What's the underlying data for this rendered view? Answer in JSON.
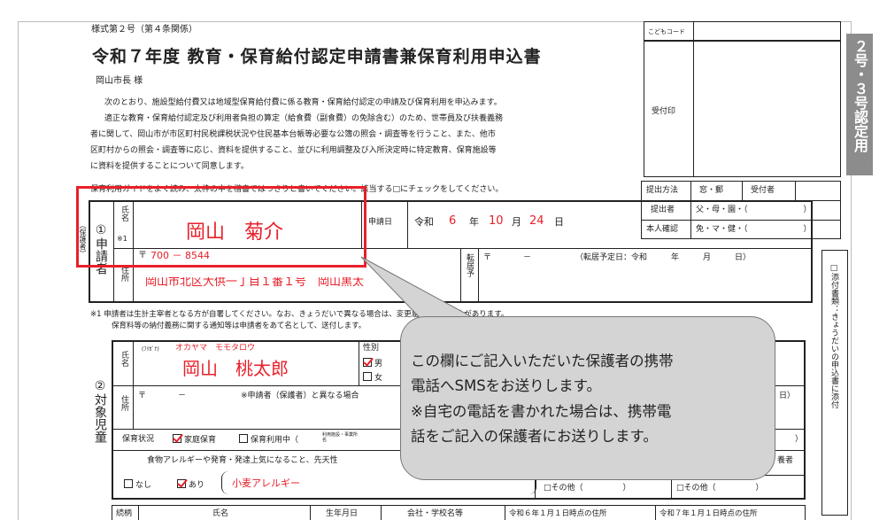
{
  "form": {
    "form_no": "様式第２号（第４条関係）",
    "title": "令和７年度 教育・保育給付認定申請書兼保育利用申込書",
    "addressee": "岡山市長 様",
    "intro": [
      "次のとおり、施設型給付費又は地域型保育給付費に係る教育・保育給付認定の申請及び保育利用を申込みます。",
      "適正な教育・保育給付認定及び利用者負担の算定（給食費（副食費）の免除含む）のため、世帯員及び扶養義務",
      "者に関して、岡山市が市区町村民税課税状況や住民基本台帳等必要な公簿の照会・調査等を行うこと、また、他市",
      "区町村からの照会・調査等に応じ、資料を提供すること、並びに利用調整及び入所決定時に特定教育、保育施設等",
      "に資料を提供することについて同意します。"
    ],
    "guide_line": "保育利用ガイドをよく読み、太枠の中を楷書ではっきりと書いてください。該当する□にチェックをしてください。",
    "child_code_label": "こどもコード",
    "reception_label": "受付印",
    "side_tab": "２号・３号認定用",
    "submit": {
      "method_label": "提出方法",
      "method_options": "窓・郵",
      "receiver_label": "受付者",
      "submitter_label": "提出者",
      "submitter_options": "父・母・園・（　　　　　　　）",
      "identity_label": "本人確認",
      "identity_options": "免・マ・健・（　　　　　　　）"
    },
    "applicant": {
      "section": "①申請者",
      "side_note": "（保護者）",
      "name_label": "氏名",
      "name_note": "※1",
      "name_value": "岡山　菊介",
      "date_label": "申請日",
      "era": "令和",
      "year": "6",
      "year_unit": "年",
      "month": "10",
      "month_unit": "月",
      "day": "24",
      "day_unit": "日",
      "postal_mark": "〒",
      "postal_value": "700 － 8544",
      "address_label": "住所",
      "address_value": "岡山市北区大供一丁目１番１号　岡山黒太",
      "move_label": "転居予",
      "move_postal": "〒　　　　－",
      "move_date": "（転居予定日：令和　　　年　　　月　　　日）"
    },
    "notes": [
      "※1 申請者は生計主宰者となる方が自署してください。なお、きょうだいで異なる場合は、変更届を求める場合があります。",
      "保育料等の納付義務に関する通知等は申請者をあて名として、送付します。"
    ],
    "child": {
      "section": "②対象児童",
      "furigana_label": "(ﾌﾘｶﾞﾅ)",
      "furigana_value": "オカヤマ　モモタロウ",
      "name_label": "氏名",
      "name_value": "岡山　桃太郎",
      "gender_label": "性別",
      "male": "男",
      "female": "女",
      "address_label": "住所",
      "address_postal": "〒　　　　－",
      "address_note": "※申請者（保護者）と異なる場合",
      "close_paren": "日）",
      "care_label": "保育状況",
      "care_home": "家庭保育",
      "care_using": "保育利用中（",
      "care_small": "利用施設・事業所名",
      "care_close": "）",
      "allergy_text": "食物アレルギーや発育・発達上気になること、先天性",
      "guardian_suffix": "養者",
      "allergy_none": "なし",
      "allergy_yes": "あり",
      "allergy_value": "小麦アレルギー",
      "other_label": "□その他（　　　　　）",
      "other_label2": "□その他（　　　　　）"
    },
    "attachment_note": "□添付書類：きょうだいの申込書に添付",
    "family_header": {
      "relation": "続柄",
      "name": "氏名",
      "birth": "生年月日",
      "school": "会社・学校名等",
      "addr_r6": "令和６年１月１日時点の住所",
      "addr_r7": "令和７年１月１日時点の住所"
    },
    "callout": {
      "text": "この欄にご記入いただいた保護者の携帯電話へSMSをお送りします。※自宅の電話を書かれた場合は、携帯電話をご記入の保護者にお送りします。",
      "lines": [
        "この欄にご記入いただいた保護者の携帯",
        "電話へSMSをお送りします。",
        "※自宅の電話を書かれた場合は、携帯電",
        "話をご記入の保護者にお送りします。"
      ]
    }
  },
  "colors": {
    "highlight": "#e8202a",
    "callout_bg": "#d4d4d4",
    "tab_bg": "#8c8c8c"
  }
}
